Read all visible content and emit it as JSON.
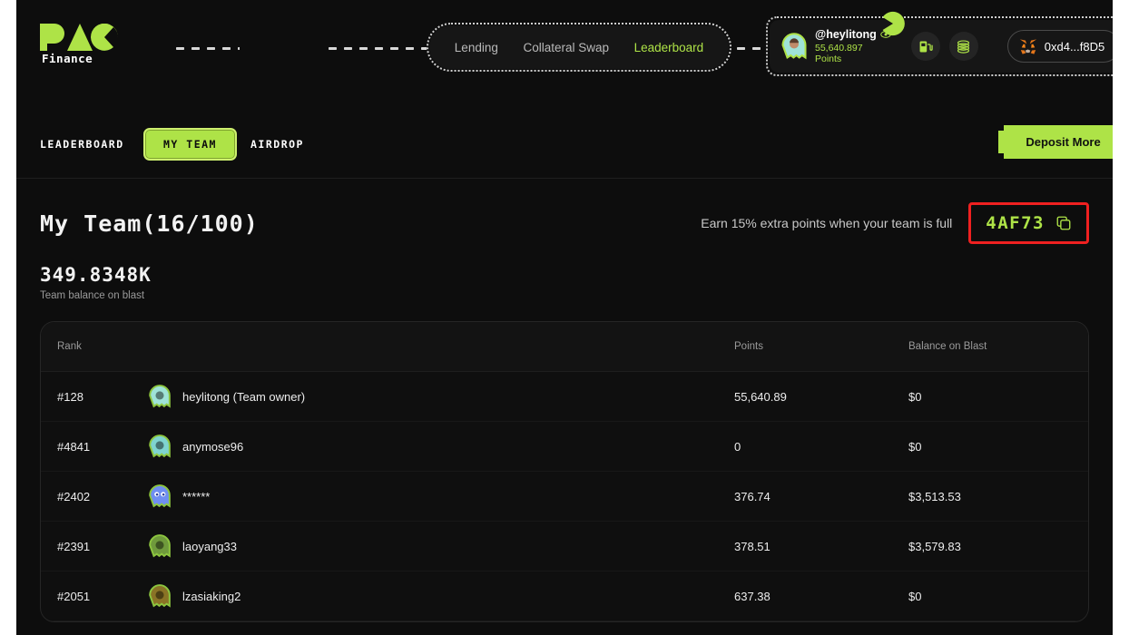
{
  "header": {
    "logo": {
      "mark": "PAC",
      "sub": "Finance"
    },
    "nav": [
      {
        "label": "Lending",
        "active": false
      },
      {
        "label": "Collateral Swap",
        "active": false
      },
      {
        "label": "Leaderboard",
        "active": true
      }
    ],
    "user": {
      "name": "@heylitong",
      "points": "55,640.897 Points",
      "eye_icon": "eye-icon",
      "avatar_icon": "user-avatar-ghost"
    },
    "icons": [
      {
        "name": "gas-pump-icon"
      },
      {
        "name": "coins-stack-icon"
      }
    ],
    "wallet": {
      "address": "0xd4...f8D5",
      "icon": "metamask-fox-icon"
    },
    "decoration": {
      "pacman": "pacman-icon"
    }
  },
  "tabs": [
    {
      "label": "LEADERBOARD",
      "active": false
    },
    {
      "label": "MY TEAM",
      "active": true
    },
    {
      "label": "AIRDROP",
      "active": false
    }
  ],
  "deposit_button": {
    "label": "Deposit More"
  },
  "page": {
    "title": "My Team(16/100)",
    "promo_text": "Earn 15% extra points when your team is full",
    "referral_code": "4AF73",
    "copy_icon": "copy-icon",
    "balance_value": "349.8348K",
    "balance_label": "Team balance on blast"
  },
  "table": {
    "headers": {
      "rank": "Rank",
      "user": "",
      "points": "Points",
      "balance": "Balance on Blast"
    },
    "rows": [
      {
        "rank": "#128",
        "name": "heylitong (Team owner)",
        "points": "55,640.89",
        "balance": "$0",
        "avatar_color": "#9fe3d8",
        "avatar_icon": "ghost-avatar"
      },
      {
        "rank": "#4841",
        "name": "anymose96",
        "points": "0",
        "balance": "$0",
        "avatar_color": "#7fd4d0",
        "avatar_icon": "ghost-avatar"
      },
      {
        "rank": "#2402",
        "name": "******",
        "points": "376.74",
        "balance": "$3,513.53",
        "avatar_color": "#6f8ef2",
        "avatar_icon": "ghost-avatar"
      },
      {
        "rank": "#2391",
        "name": "laoyang33",
        "points": "378.51",
        "balance": "$3,579.83",
        "avatar_color": "#6f9a3c",
        "avatar_icon": "ghost-avatar"
      },
      {
        "rank": "#2051",
        "name": "lzasiaking2",
        "points": "637.38",
        "balance": "$0",
        "avatar_color": "#8a7326",
        "avatar_icon": "ghost-avatar"
      }
    ]
  },
  "colors": {
    "accent_green": "#aee347",
    "background": "#0d0d0d",
    "card": "#0f0f0f",
    "highlight_red": "#ef2020"
  }
}
